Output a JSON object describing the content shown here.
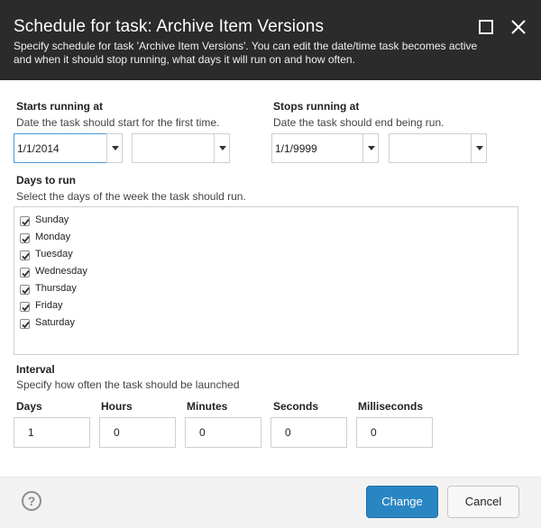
{
  "dialog": {
    "title": "Schedule for task: Archive Item Versions",
    "subtitle": "Specify schedule for task 'Archive Item Versions'. You can edit the date/time task becomes active and when it should stop running, what days it will run on and how often.",
    "header_buttons": [
      "maximize-icon",
      "close-icon"
    ]
  },
  "starts": {
    "label": "Starts running at",
    "help": "Date the task should start for the first time.",
    "date_value": "1/1/2014",
    "time_value": ""
  },
  "stops": {
    "label": "Stops running at",
    "help": "Date the task should end being run.",
    "date_value": "1/1/9999",
    "time_value": ""
  },
  "days": {
    "label": "Days to run",
    "help": "Select the days of the week the task should run.",
    "items": [
      {
        "label": "Sunday",
        "checked": true
      },
      {
        "label": "Monday",
        "checked": true
      },
      {
        "label": "Tuesday",
        "checked": true
      },
      {
        "label": "Wednesday",
        "checked": true
      },
      {
        "label": "Thursday",
        "checked": true
      },
      {
        "label": "Friday",
        "checked": true
      },
      {
        "label": "Saturday",
        "checked": true
      }
    ]
  },
  "interval": {
    "label": "Interval",
    "help": "Specify how often the task should be launched",
    "fields": [
      {
        "label": "Days",
        "value": "1"
      },
      {
        "label": "Hours",
        "value": "0"
      },
      {
        "label": "Minutes",
        "value": "0"
      },
      {
        "label": "Seconds",
        "value": "0"
      },
      {
        "label": "Milliseconds",
        "value": "0"
      }
    ]
  },
  "footer": {
    "help_icon": "?",
    "primary_label": "Change",
    "secondary_label": "Cancel"
  },
  "colors": {
    "header_bg": "#2b2b2b",
    "primary_button": "#2a86c3",
    "focus_border": "#4e9ad6"
  }
}
